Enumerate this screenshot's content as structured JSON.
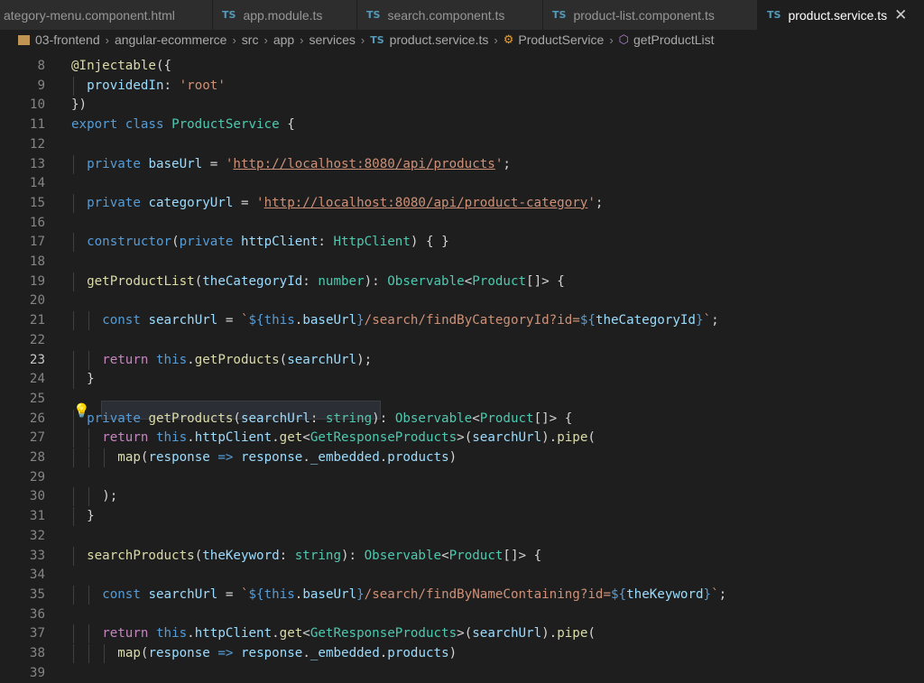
{
  "tabs": [
    {
      "label": "ategory-menu.component.html",
      "icon": "html-file",
      "active": false
    },
    {
      "label": "app.module.ts",
      "icon": "TS",
      "active": false
    },
    {
      "label": "search.component.ts",
      "icon": "TS",
      "active": false
    },
    {
      "label": "product-list.component.ts",
      "icon": "TS",
      "active": false
    },
    {
      "label": "product.service.ts",
      "icon": "TS",
      "active": true
    }
  ],
  "breadcrumbs": {
    "items": [
      "03-frontend",
      "angular-ecommerce",
      "src",
      "app",
      "services"
    ],
    "file": "product.service.ts",
    "file_icon": "TS",
    "class": "ProductService",
    "method": "getProductList"
  },
  "editor": {
    "line_numbers": [
      "8",
      "9",
      "10",
      "11",
      "12",
      "13",
      "14",
      "15",
      "16",
      "17",
      "18",
      "19",
      "20",
      "21",
      "22",
      "23",
      "24",
      "25",
      "26",
      "27",
      "28",
      "29",
      "30",
      "31",
      "32",
      "33",
      "34",
      "35",
      "36",
      "37",
      "38",
      "39"
    ],
    "lines": [
      "@Injectable({",
      "  providedIn: 'root'",
      "})",
      "export class ProductService {",
      "",
      "  private baseUrl = 'http://localhost:8080/api/products';",
      "",
      "  private categoryUrl = 'http://localhost:8080/api/product-category';",
      "",
      "  constructor(private httpClient: HttpClient) { }",
      "",
      "  getProductList(theCategoryId: number): Observable<Product[]> {",
      "",
      "    const searchUrl = `${this.baseUrl}/search/findByCategoryId?id=${theCategoryId}`;",
      "",
      "    return this.getProducts(searchUrl);",
      "  }",
      "",
      "  private getProducts(searchUrl: string): Observable<Product[]> {",
      "    return this.httpClient.get<GetResponseProducts>(searchUrl).pipe(",
      "      map(response => response._embedded.products)",
      "",
      "    );",
      "  }",
      "",
      "  searchProducts(theKeyword: string): Observable<Product[]> {",
      "",
      "    const searchUrl = `${this.baseUrl}/search/findByNameContaining?id=${theKeyword}`;",
      "",
      "    return this.httpClient.get<GetResponseProducts>(searchUrl).pipe(",
      "      map(response => response._embedded.products)",
      ""
    ],
    "active_line": "23",
    "lightbulb_icon": "lightbulb-icon"
  },
  "colors": {
    "background": "#1e1e1e",
    "keyword": "#569cd6",
    "string": "#ce9178",
    "function": "#dcdcaa",
    "type": "#4ec9b0",
    "variable": "#9cdcfe",
    "control": "#c586c0"
  }
}
